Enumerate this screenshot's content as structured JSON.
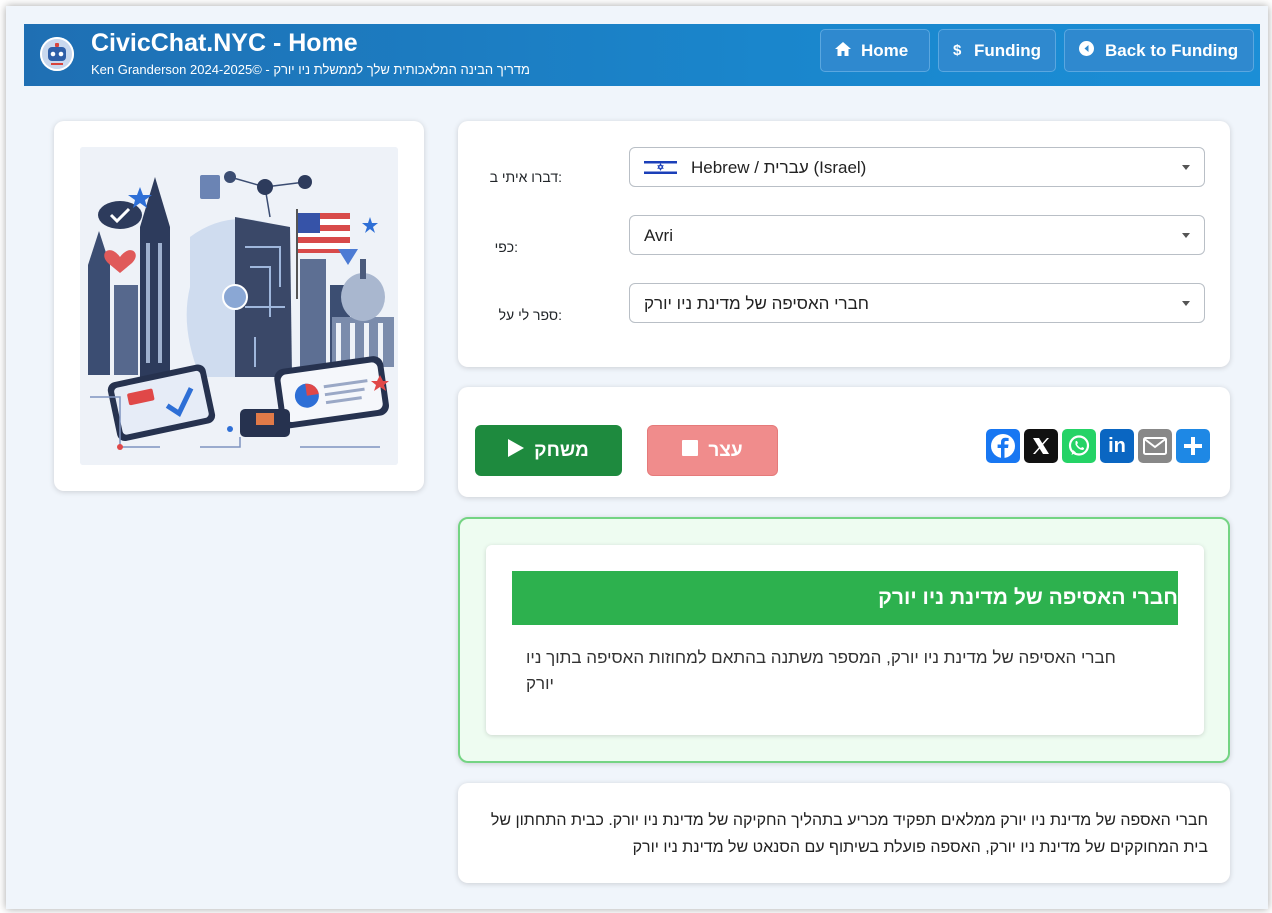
{
  "header": {
    "title": "CivicChat.NYC - Home",
    "subtitle": "Ken Granderson מדריך הבינה המלאכותית שלך לממשלת ניו יורק - ©2024-2025",
    "nav": [
      {
        "label": "Home",
        "icon": "home-icon"
      },
      {
        "label": "Funding",
        "icon": "dollar-icon"
      },
      {
        "label": "Back to Funding",
        "icon": "arrow-circle-left-icon"
      }
    ]
  },
  "form": {
    "language_label": ":דברו איתי ב",
    "language_value": "Hebrew / עברית (Israel)",
    "language_flag": "israel-flag-icon",
    "persona_label": ":כפי",
    "persona_value": "Avri",
    "topic_label": ":ספר לי על",
    "topic_value": "חברי האסיפה של מדינת ניו יורק"
  },
  "controls": {
    "play_label": "משחק",
    "stop_label": "עצר",
    "share_icons": [
      "facebook-icon",
      "x-icon",
      "whatsapp-icon",
      "linkedin-icon",
      "email-icon",
      "share-plus-icon"
    ]
  },
  "topic_card": {
    "title": "חברי האסיפה של מדינת ניו יורק",
    "description": "חברי האסיפה של מדינת ניו יורק, המספר משתנה בהתאם למחוזות האסיפה בתוך ניו יורק"
  },
  "transcript": {
    "text": "חברי האספה של מדינת ניו יורק ממלאים תפקיד מכריע בתהליך החקיקה של מדינת ניו יורק. כבית התחתון של בית המחוקקים של מדינת ניו יורק, האספה פועלת בשיתוף עם הסנאט של מדינת ניו יורק"
  },
  "colors": {
    "header_blue": "#1a7fc4",
    "play_green": "#1e8a3e",
    "stop_red": "#f08c8c",
    "topic_green": "#2db14e",
    "facebook": "#1877f2",
    "x": "#111111",
    "whatsapp": "#25d366",
    "linkedin": "#0a66c2",
    "email": "#888888",
    "share": "#1e88e5"
  }
}
